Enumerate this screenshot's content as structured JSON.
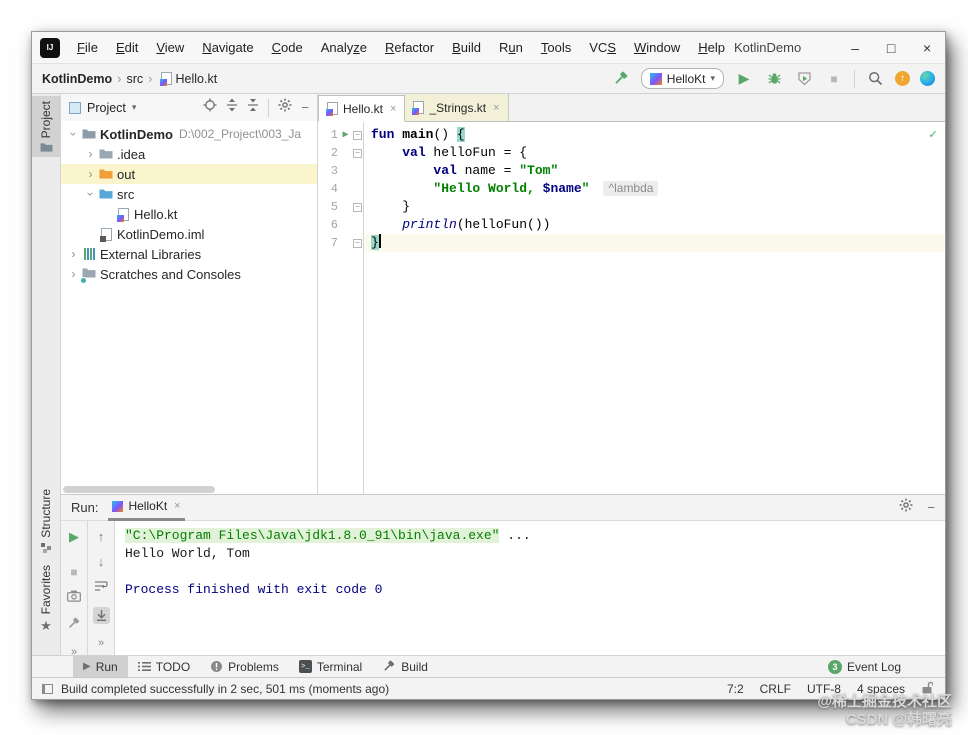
{
  "window": {
    "app_logo": "IJ",
    "title": "KotlinDemo"
  },
  "controls": {
    "minimize": "–",
    "maximize": "□",
    "close": "×"
  },
  "glyphs": {
    "close": "×",
    "chevron": "›",
    "combo_arrow": "▾",
    "more": "»",
    "up": "↑",
    "down": "↓",
    "run": "▶",
    "stop": "■",
    "check": "✓",
    "minus": "−",
    "fold": "−"
  },
  "menu": {
    "items": [
      {
        "label": "File",
        "u": 0
      },
      {
        "label": "Edit",
        "u": 0
      },
      {
        "label": "View",
        "u": 0
      },
      {
        "label": "Navigate",
        "u": 0
      },
      {
        "label": "Code",
        "u": 0
      },
      {
        "label": "Analyze",
        "u": 5
      },
      {
        "label": "Refactor",
        "u": 0
      },
      {
        "label": "Build",
        "u": 0
      },
      {
        "label": "Run",
        "u": 1
      },
      {
        "label": "Tools",
        "u": 0
      },
      {
        "label": "VCS",
        "u": 2
      },
      {
        "label": "Window",
        "u": 0
      },
      {
        "label": "Help",
        "u": 0
      }
    ]
  },
  "breadcrumb": [
    "KotlinDemo",
    "src",
    "Hello.kt"
  ],
  "toolbar": {
    "run_config": "HelloKt"
  },
  "stripe": {
    "project": "Project",
    "structure": "Structure",
    "favorites": "Favorites"
  },
  "project": {
    "header_title": "Project",
    "rows": [
      {
        "chevron": "expanded",
        "icon": "project-folder",
        "label": "KotlinDemo",
        "bold": true,
        "suffix": "D:\\002_Project\\003_Ja",
        "level": 0
      },
      {
        "chevron": "collapsed",
        "icon": "folder-gray",
        "label": ".idea",
        "level": 1
      },
      {
        "chevron": "collapsed",
        "icon": "folder-orange",
        "label": "out",
        "level": 1,
        "highlight": true
      },
      {
        "chevron": "expanded",
        "icon": "folder-blue",
        "label": "src",
        "level": 1
      },
      {
        "icon": "kotlin-file",
        "label": "Hello.kt",
        "level": 2
      },
      {
        "icon": "iml-file",
        "label": "KotlinDemo.iml",
        "level": 1
      },
      {
        "chevron": "collapsed",
        "icon": "libraries",
        "label": "External Libraries",
        "level": 0
      },
      {
        "chevron": "collapsed",
        "icon": "scratches",
        "label": "Scratches and Consoles",
        "level": 0
      }
    ]
  },
  "editor": {
    "tabs": [
      {
        "label": "Hello.kt",
        "active": true
      },
      {
        "label": "_Strings.kt",
        "active": false
      }
    ],
    "lines": [
      {
        "n": "1",
        "run": true,
        "fold": true,
        "tokens": [
          {
            "t": "fun",
            "c": "kw"
          },
          {
            "t": " ",
            "c": "pl"
          },
          {
            "t": "main",
            "c": "decl"
          },
          {
            "t": "() ",
            "c": "pl"
          },
          {
            "t": "{",
            "c": "brace"
          }
        ]
      },
      {
        "n": "2",
        "fold": true,
        "tokens": [
          {
            "t": "    ",
            "c": "pl"
          },
          {
            "t": "val",
            "c": "kw"
          },
          {
            "t": " helloFun = {",
            "c": "pl"
          }
        ]
      },
      {
        "n": "3",
        "tokens": [
          {
            "t": "        ",
            "c": "pl"
          },
          {
            "t": "val",
            "c": "kw"
          },
          {
            "t": " name = ",
            "c": "pl"
          },
          {
            "t": "\"Tom\"",
            "c": "str"
          }
        ]
      },
      {
        "n": "4",
        "hint": "^lambda",
        "tokens": [
          {
            "t": "        ",
            "c": "pl"
          },
          {
            "t": "\"Hello World, ",
            "c": "str"
          },
          {
            "t": "$name",
            "c": "tmpl"
          },
          {
            "t": "\"",
            "c": "str"
          }
        ]
      },
      {
        "n": "5",
        "fold": true,
        "tokens": [
          {
            "t": "    }",
            "c": "pl"
          }
        ]
      },
      {
        "n": "6",
        "tokens": [
          {
            "t": "    ",
            "c": "pl"
          },
          {
            "t": "println",
            "c": "fncall"
          },
          {
            "t": "(helloFun())",
            "c": "pl"
          }
        ]
      },
      {
        "n": "7",
        "fold": true,
        "current": true,
        "caret": true,
        "tokens": [
          {
            "t": "}",
            "c": "brace"
          }
        ]
      }
    ]
  },
  "run_panel": {
    "label": "Run:",
    "tab": "HelloKt",
    "console": [
      {
        "segments": [
          {
            "t": "\"C:\\Program Files\\Java\\jdk1.8.0_91\\bin\\java.exe\"",
            "c": "cmd"
          },
          {
            "t": " ...",
            "c": "pl"
          }
        ]
      },
      {
        "segments": [
          {
            "t": "Hello World, Tom",
            "c": "pl"
          }
        ]
      },
      {
        "segments": []
      },
      {
        "segments": [
          {
            "t": "Process finished with exit code 0",
            "c": "sys"
          }
        ]
      }
    ]
  },
  "bottom_bar": {
    "items": [
      {
        "label": "Run",
        "icon": "run",
        "active": true
      },
      {
        "label": "TODO",
        "icon": "todo",
        "active": false
      },
      {
        "label": "Problems",
        "icon": "problems",
        "active": false
      },
      {
        "label": "Terminal",
        "icon": "terminal",
        "active": false
      },
      {
        "label": "Build",
        "icon": "build",
        "active": false
      }
    ],
    "event_log": {
      "label": "Event Log",
      "badge": "3"
    }
  },
  "status_bar": {
    "message": "Build completed successfully in 2 sec, 501 ms (moments ago)",
    "position": "7:2",
    "line_ending": "CRLF",
    "encoding": "UTF-8",
    "indent": "4 spaces"
  },
  "watermark": {
    "line1": "@稀土掘金技术社区",
    "line2": "CSDN @韩曙亮"
  },
  "colors": {
    "accent_green": "#59a869",
    "keyword": "#000080",
    "string": "#008000",
    "console_system": "#000080",
    "update_orange": "#f0a732",
    "brace_match": "#97d8ca",
    "current_line": "#fcfaed",
    "row_highlight": "#faf5cc"
  }
}
